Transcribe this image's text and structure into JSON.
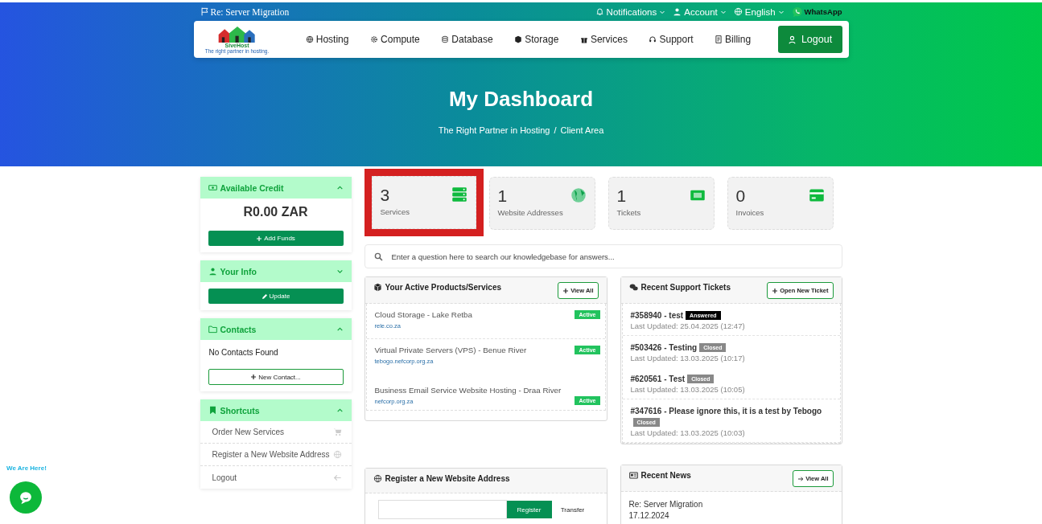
{
  "top_bar": {
    "announcement": "Re: Server Migration",
    "links": [
      {
        "label": "Notifications"
      },
      {
        "label": "Account"
      },
      {
        "label": "English"
      }
    ],
    "whatsapp": "WhatsApp"
  },
  "nav": {
    "logo": {
      "name": "SiveHost",
      "tagline": "The right partner in hosting."
    },
    "items": [
      {
        "label": "Hosting"
      },
      {
        "label": "Compute"
      },
      {
        "label": "Database"
      },
      {
        "label": "Storage"
      },
      {
        "label": "Services"
      },
      {
        "label": "Support"
      },
      {
        "label": "Billing"
      }
    ],
    "logout": "Logout"
  },
  "hero": {
    "title": "My Dashboard",
    "breadcrumb": [
      "The Right Partner in Hosting",
      "Client Area"
    ],
    "separator": "/"
  },
  "sidebar": [
    {
      "kind": "credit",
      "title": "Available Credit",
      "expanded": true,
      "amount": "R0.00 ZAR",
      "button": "Add Funds"
    },
    {
      "kind": "info",
      "title": "Your Info",
      "expanded": false,
      "button": "Update"
    },
    {
      "kind": "contacts",
      "title": "Contacts",
      "expanded": true,
      "text": "No Contacts Found",
      "button": "New Contact..."
    },
    {
      "kind": "links",
      "title": "Shortcuts",
      "expanded": true,
      "items": [
        {
          "label": "Order New Services"
        },
        {
          "label": "Register a New Website Address"
        },
        {
          "label": "Logout"
        }
      ]
    }
  ],
  "stats": [
    {
      "value": "3",
      "label": "Services",
      "highlighted": true
    },
    {
      "value": "1",
      "label": "Website Addresses",
      "highlighted": false
    },
    {
      "value": "1",
      "label": "Tickets",
      "highlighted": false
    },
    {
      "value": "0",
      "label": "Invoices",
      "highlighted": false
    }
  ],
  "search": {
    "placeholder": "Enter a question here to search our knowledgebase for answers..."
  },
  "products": {
    "title": "Your Active Products/Services",
    "button": "View All",
    "items": [
      {
        "name": "Cloud Storage - Lake Retba",
        "domain": "rele.co.za",
        "status": "Active"
      },
      {
        "name": "Virtual Private Servers (VPS) - Benue River",
        "domain": "tebogo.nefcorp.org.za",
        "status": "Active"
      },
      {
        "name": "Business Email Service Website Hosting - Draa River",
        "domain": "nefcorp.org.za",
        "status": "Active"
      }
    ]
  },
  "tickets": {
    "title": "Recent Support Tickets",
    "button": "Open New Ticket",
    "items": [
      {
        "subject": "#358940 - test",
        "status": "Answered",
        "kind": "answered",
        "updated": "Last Updated: 25.04.2025 (12:47)"
      },
      {
        "subject": "#503426 - Testing",
        "status": "Closed",
        "kind": "closed",
        "updated": "Last Updated: 13.03.2025 (10:17)"
      },
      {
        "subject": "#620561 - Test",
        "status": "Closed",
        "kind": "closed",
        "updated": "Last Updated: 13.03.2025 (10:05)"
      },
      {
        "subject": "#347616 - Please ignore this, it is a test by Tebogo",
        "status": "Closed",
        "kind": "closed",
        "updated": "Last Updated: 13.03.2025 (10:03)"
      }
    ]
  },
  "domain": {
    "title": "Register a New Website Address",
    "register": "Register",
    "transfer": "Transfer"
  },
  "news": {
    "title": "Recent News",
    "button": "View All",
    "items": [
      {
        "title": "Re: Server Migration",
        "date": "17.12.2024"
      }
    ]
  },
  "chat": {
    "label": "We Are Here!"
  }
}
